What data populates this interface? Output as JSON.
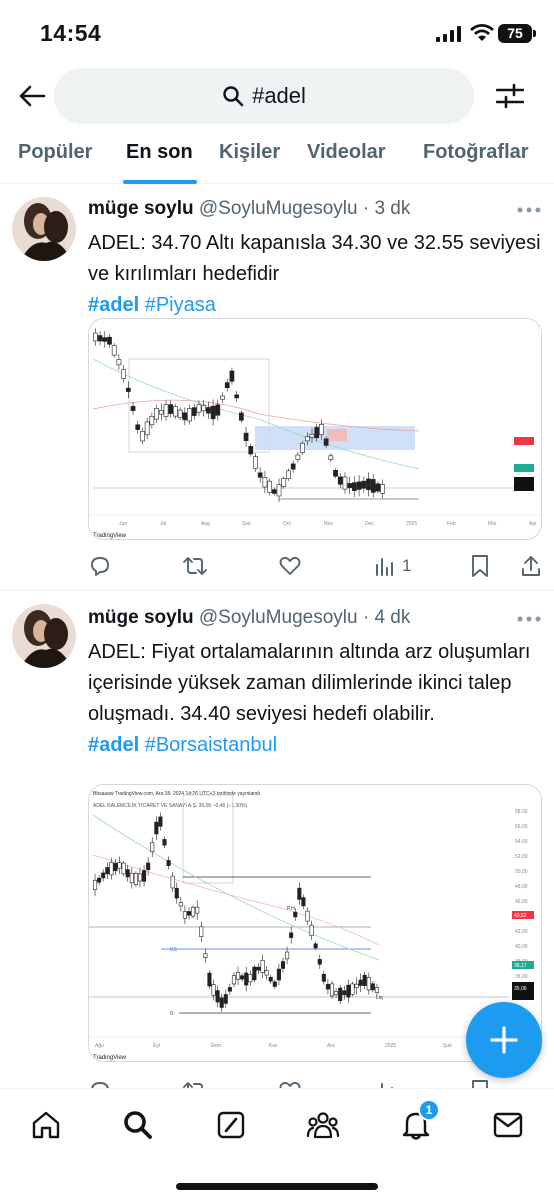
{
  "status_bar": {
    "time": "14:54",
    "battery": "75"
  },
  "search": {
    "query": "#adel"
  },
  "tabs": [
    {
      "label": "Popüler"
    },
    {
      "label": "En son"
    },
    {
      "label": "Kişiler"
    },
    {
      "label": "Videolar"
    },
    {
      "label": "Fotoğraflar"
    }
  ],
  "posts": [
    {
      "name": "müge soylu",
      "handle": "@SoyluMugesoylu",
      "time": "· 3 dk",
      "text": "ADEL: 34.70 Altı kapanısla 34.30 ve 32.55 seviyesi ve kırılımları hedefidir",
      "hashtags": [
        "#adel",
        "#Piyasa"
      ],
      "views": "1"
    },
    {
      "name": "müge soylu",
      "handle": "@SoyluMugesoylu",
      "time": "· 4 dk",
      "text": "ADEL: Fiyat ortalamalarının altında arz oluşumları içerisinde yüksek zaman dilimlerinde ikinci talep oluşmadı. 34.40 seviyesi hedefi olabilir.",
      "hashtags": [
        "#adel",
        "#Borsaistanbul"
      ]
    }
  ],
  "chart2_labels": {
    "header": "Bbsaaaw TradingView.com, Ara 18, 2024 14:26 UTC+3 tarihinde yayınlandı",
    "symbol": "ADEL KALEMCİLİK TİCARET VE SANAYİ A.Ş. 35,06 −0,46 (−1,30%)",
    "fib_top": "1",
    "fib_mid": "0.5",
    "fib_bottom": "0",
    "poi": "P.H",
    "liq": "Liq",
    "price_red": "43,52",
    "price_teal": "38,17",
    "price_last": "35,06",
    "x_ticks": [
      "Ağu",
      "Eyl",
      "Ekm",
      "Kas",
      "Ara",
      "2025",
      "Şub"
    ],
    "y_ticks": [
      "58,00",
      "56,00",
      "54,00",
      "52,00",
      "50,00",
      "48,00",
      "46,00",
      "44,00",
      "42,00",
      "40,00",
      "38,00",
      "36,00",
      "34,00"
    ],
    "brand": "TradingView"
  },
  "chart1_labels": {
    "x_ticks": [
      "Jun",
      "Jul",
      "Aug",
      "Sep",
      "Oct",
      "Nov",
      "Dec",
      "2025",
      "Feb",
      "Mar",
      "Apr"
    ],
    "brand": "TradingView"
  },
  "colors": {
    "accent": "#1d9bf0",
    "text_primary": "#0f1419",
    "text_secondary": "#536471",
    "zone_blue": "#c9d9f7",
    "zone_red": "#f4b6b0",
    "price_red": "#f23645",
    "price_teal": "#22ab94"
  },
  "bottom_nav": {
    "notification_count": "1"
  }
}
